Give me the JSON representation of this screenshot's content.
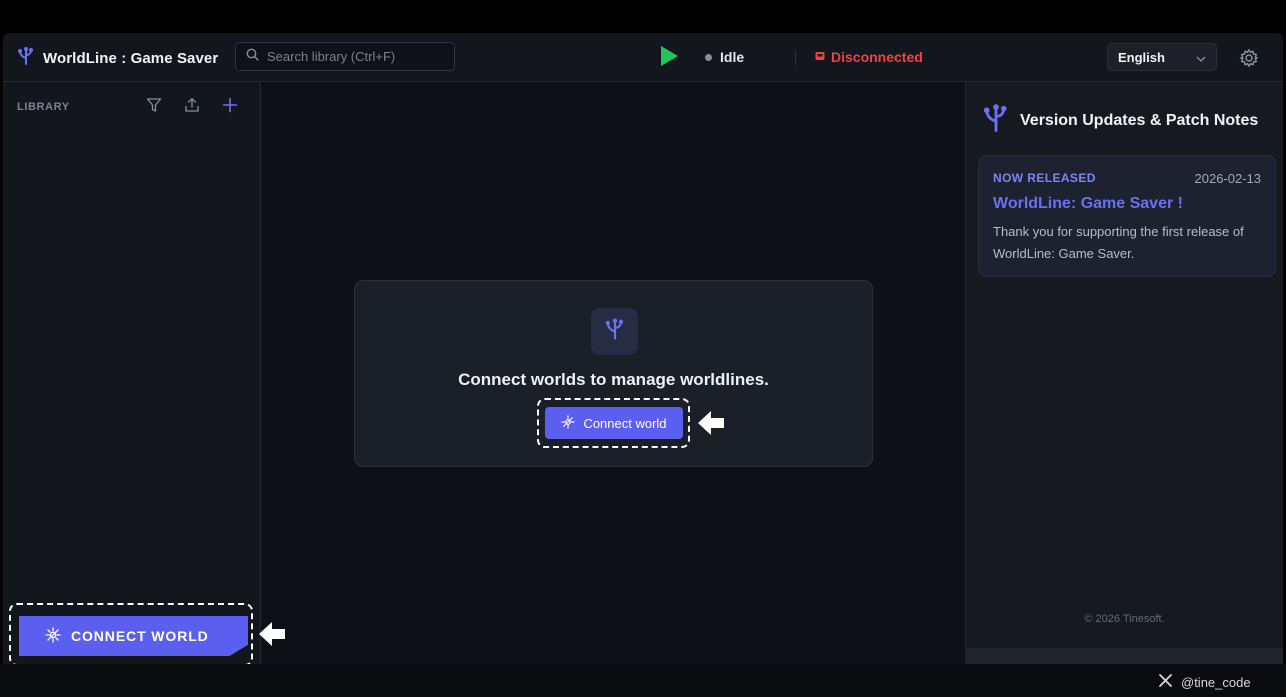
{
  "header": {
    "app_title": "WorldLine : Game Saver",
    "search_placeholder": "Search library (Ctrl+F)",
    "status_label": "Idle",
    "connection_label": "Disconnected",
    "language_selected": "English"
  },
  "sidebar": {
    "library_label": "LIBRARY",
    "connect_world_label": "CONNECT WORLD"
  },
  "main": {
    "empty_title": "Connect worlds to manage worldlines.",
    "connect_button_label": "Connect world"
  },
  "patch_notes": {
    "title": "Version Updates & Patch Notes",
    "tag": "NOW RELEASED",
    "date": "2026-02-13",
    "note_title": "WorldLine: Game Saver !",
    "note_body": "Thank you for supporting the first release of WorldLine: Game Saver.",
    "copyright": "© 2026 Tinesoft."
  },
  "footer": {
    "handle": "@tine_code"
  },
  "colors": {
    "accent": "#5b5ff0",
    "accent_text": "#6a6ff6",
    "play_green": "#22c55e",
    "disconnected_red": "#ef4444"
  },
  "icons": [
    "worldline-logo-icon",
    "search-icon",
    "play-icon",
    "status-dot-icon",
    "disconnected-icon",
    "chevron-down-icon",
    "gear-icon",
    "filter-icon",
    "upload-icon",
    "plus-icon",
    "connect-icon",
    "arrow-left-icon",
    "x-logo-icon"
  ]
}
